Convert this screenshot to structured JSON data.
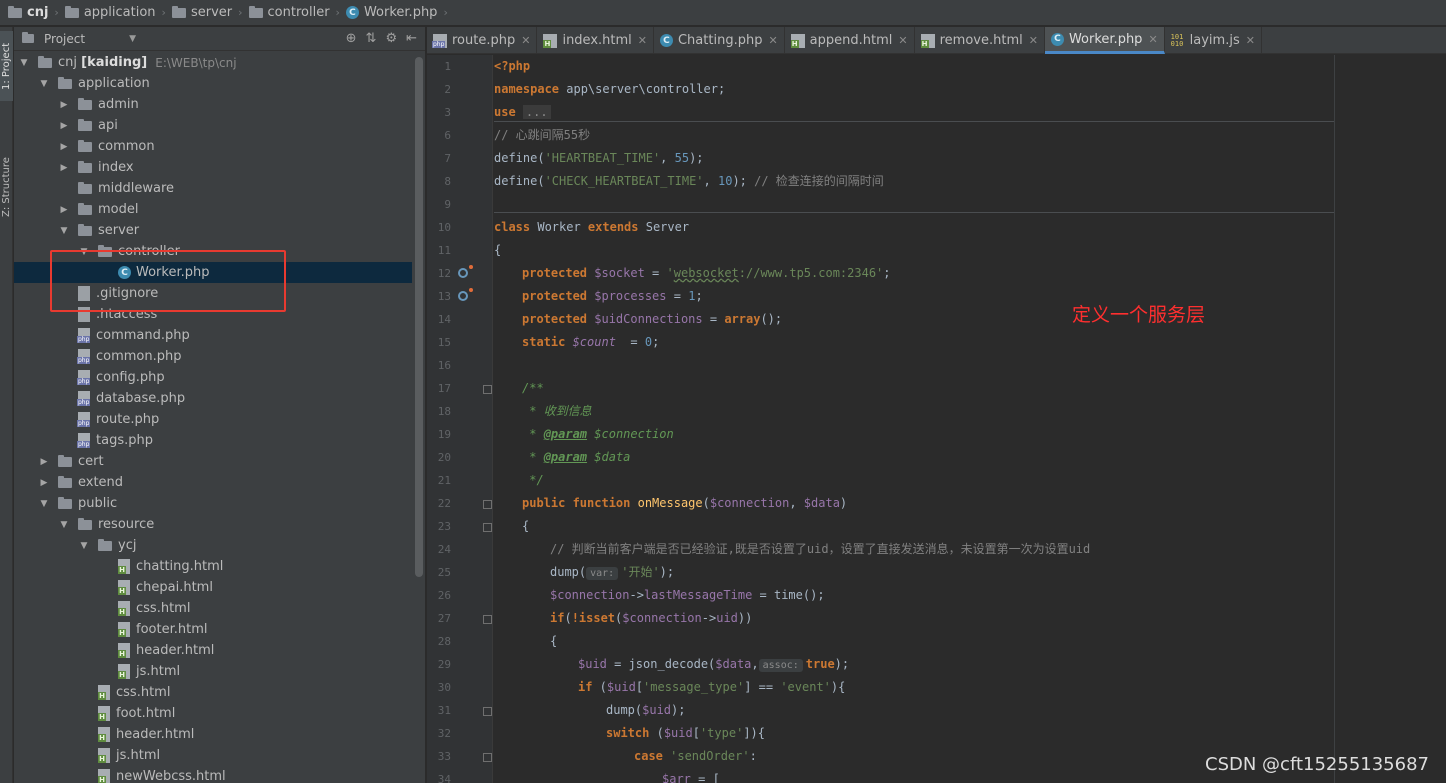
{
  "breadcrumb": [
    "cnj",
    "application",
    "server",
    "controller",
    "Worker.php"
  ],
  "toolstrip": {
    "project": "1: Project",
    "structure": "Z: Structure"
  },
  "project_panel": {
    "title": "Project"
  },
  "tree": [
    {
      "label": "cnj",
      "bold": "[kaiding]",
      "path": "E:\\WEB\\tp\\cnj"
    },
    {
      "label": "application"
    },
    {
      "label": "admin"
    },
    {
      "label": "api"
    },
    {
      "label": "common"
    },
    {
      "label": "index"
    },
    {
      "label": "middleware"
    },
    {
      "label": "model"
    },
    {
      "label": "server"
    },
    {
      "label": "controller"
    },
    {
      "label": "Worker.php"
    },
    {
      "label": ".gitignore"
    },
    {
      "label": ".htaccess"
    },
    {
      "label": "command.php"
    },
    {
      "label": "common.php"
    },
    {
      "label": "config.php"
    },
    {
      "label": "database.php"
    },
    {
      "label": "route.php"
    },
    {
      "label": "tags.php"
    },
    {
      "label": "cert"
    },
    {
      "label": "extend"
    },
    {
      "label": "public"
    },
    {
      "label": "resource"
    },
    {
      "label": "ycj"
    },
    {
      "label": "chatting.html"
    },
    {
      "label": "chepai.html"
    },
    {
      "label": "css.html"
    },
    {
      "label": "footer.html"
    },
    {
      "label": "header.html"
    },
    {
      "label": "js.html"
    },
    {
      "label": "css.html"
    },
    {
      "label": "foot.html"
    },
    {
      "label": "header.html"
    },
    {
      "label": "js.html"
    },
    {
      "label": "newWebcss.html"
    }
  ],
  "tabs": [
    "route.php",
    "index.html",
    "Chatting.php",
    "append.html",
    "remove.html",
    "Worker.php",
    "layim.js"
  ],
  "code": {
    "l1": "<?php",
    "l2_kw": "namespace",
    "l2": " app\\server\\controller;",
    "l3_kw": "use",
    "l3_fold": "...",
    "l6": "// 心跳间隔55秒",
    "l7a": "define(",
    "l7s": "'HEARTBEAT_TIME'",
    "l7b": ", ",
    "l7n": "55",
    "l7c": ");",
    "l8a": "define(",
    "l8s": "'CHECK_HEARTBEAT_TIME'",
    "l8b": ", ",
    "l8n": "10",
    "l8c": "); ",
    "l8cm": "// 检查连接的间隔时间",
    "l10_kw1": "class",
    "l10_name": " Worker ",
    "l10_kw2": "extends",
    "l10_base": " Server",
    "l11": "{",
    "l12_kw": "protected",
    "l12_var": " $socket",
    "l12_eq": " = ",
    "l12_s1": "'",
    "l12_s2": "websocket",
    "l12_s3": "://www.tp5.com:2346'",
    "l12_end": ";",
    "l13_kw": "protected",
    "l13_var": " $processes",
    "l13_eq": " = ",
    "l13_n": "1",
    "l13_end": ";",
    "l14_kw": "protected",
    "l14_var": " $uidConnections",
    "l14_eq": " = ",
    "l14_arr": "array",
    "l14_end": "();",
    "l15_kw": "static",
    "l15_var": " $count",
    "l15_eq": "  = ",
    "l15_n": "0",
    "l15_end": ";",
    "l17": "/**",
    "l18": " * 收到信息",
    "l19a": " * ",
    "l19t": "@param",
    "l19v": " $connection",
    "l20a": " * ",
    "l20t": "@param",
    "l20v": " $data",
    "l21": " */",
    "l22_kw": "public function",
    "l22_fn": " onMessage",
    "l22a": "(",
    "l22v1": "$connection",
    "l22b": ", ",
    "l22v2": "$data",
    "l22c": ")",
    "l23": "{",
    "l24": "// 判断当前客户端是否已经验证,既是否设置了uid，设置了直接发送消息，未设置第一次为设置uid",
    "l25a": "dump(",
    "l25h": "var:",
    "l25s": "'开始'",
    "l25b": ");",
    "l26v": "$connection",
    "l26a": "->",
    "l26f": "lastMessageTime",
    "l26b": " = time();",
    "l27_kw": "if",
    "l27a": "(",
    "l27n": "!isset",
    "l27b": "(",
    "l27v": "$connection",
    "l27c": "->",
    "l27f": "uid",
    "l27d": "))",
    "l28": "{",
    "l29v": "$uid",
    "l29a": " = json_decode(",
    "l29v2": "$data",
    "l29b": ",",
    "l29h": "assoc:",
    "l29t": "true",
    "l29c": ");",
    "l30_kw": "if",
    "l30a": " (",
    "l30v": "$uid",
    "l30b": "[",
    "l30s1": "'message_type'",
    "l30c": "] == ",
    "l30s2": "'event'",
    "l30d": "){",
    "l31a": "dump(",
    "l31v": "$uid",
    "l31b": ");",
    "l32_kw": "switch",
    "l32a": " (",
    "l32v": "$uid",
    "l32b": "[",
    "l32s": "'type'",
    "l32c": "]){",
    "l33_kw": "case",
    "l33s": " 'sendOrder'",
    "l33a": ":",
    "l34v": "$arr",
    "l34a": " = ["
  },
  "line_numbers": [
    "1",
    "2",
    "3",
    "6",
    "7",
    "8",
    "9",
    "10",
    "11",
    "12",
    "13",
    "14",
    "15",
    "16",
    "17",
    "18",
    "19",
    "20",
    "21",
    "22",
    "23",
    "24",
    "25",
    "26",
    "27",
    "28",
    "29",
    "30",
    "31",
    "32",
    "33",
    "34"
  ],
  "annotation": "定义一个服务层",
  "watermark": "CSDN @cft15255135687",
  "colors": {
    "accent": "#4a88c7",
    "highlight_box": "#e83a30",
    "annotation": "#ff2f2f"
  }
}
